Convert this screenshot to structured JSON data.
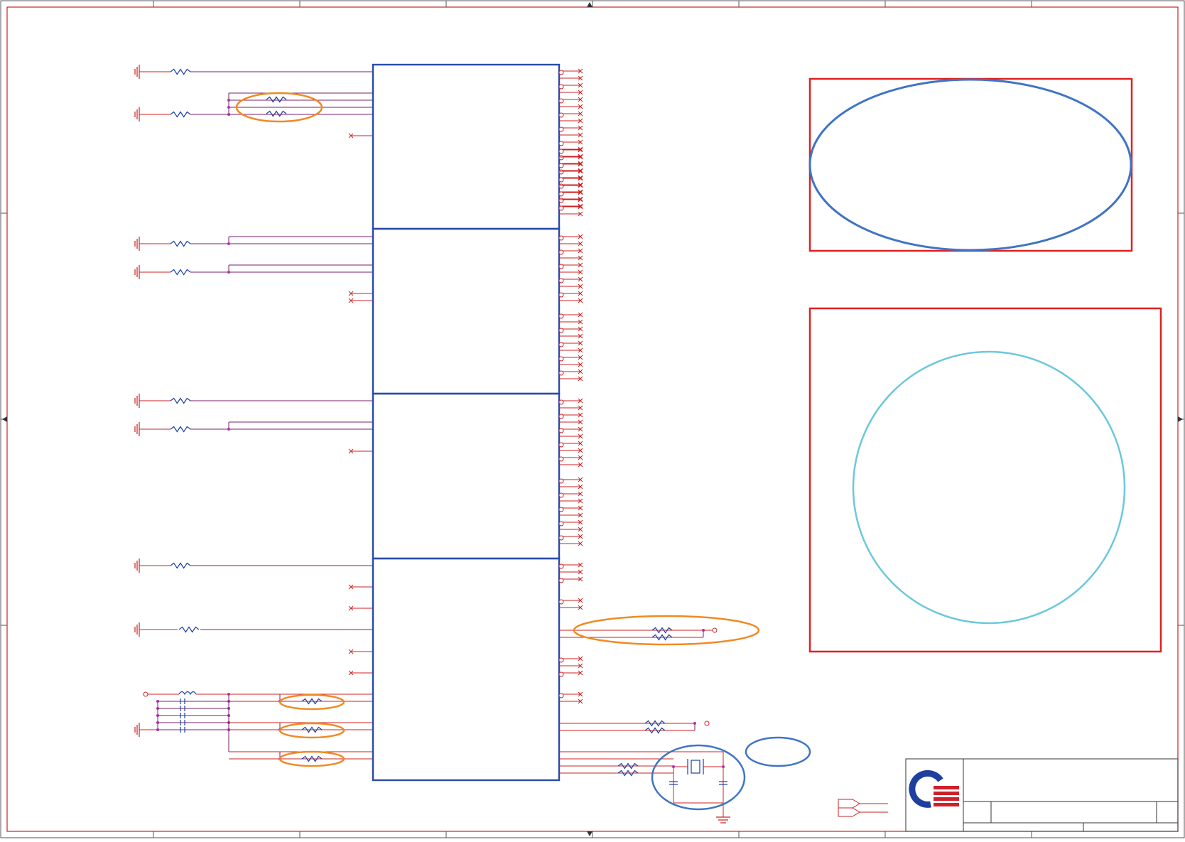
{
  "sheet": {
    "paper": "#ffffff",
    "frame_color": "#555555",
    "zone_count_top": 8,
    "zone_count_side": 4
  },
  "colors": {
    "wire": "#cc2222",
    "net": "#7a1f6e",
    "component": "#1e3f9e",
    "block_border": "#2a4aa8",
    "highlight_orange": "#f08a24",
    "highlight_blue": "#3f74c4",
    "highlight_cyan": "#6cc8dc",
    "highlight_red_box": "#e02020",
    "junction": "#b030b0",
    "logo_blue": "#1e3f9e",
    "logo_red": "#d0202a"
  },
  "blocks": [
    {
      "id": "ic-part-a"
    },
    {
      "id": "ic-part-b"
    },
    {
      "id": "ic-part-c"
    },
    {
      "id": "ic-part-d"
    }
  ],
  "title_block": {
    "logo": "company-logo",
    "fields": [
      "",
      "",
      "",
      ""
    ]
  }
}
